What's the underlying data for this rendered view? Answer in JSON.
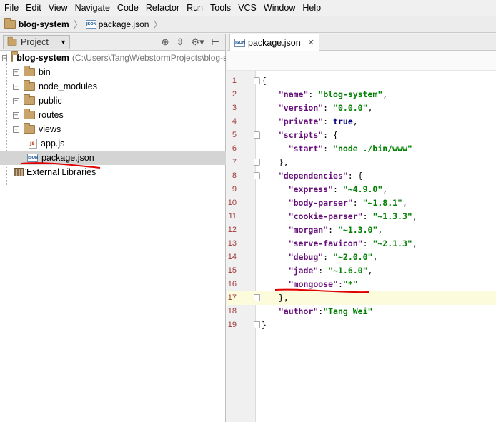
{
  "menu": [
    "File",
    "Edit",
    "View",
    "Navigate",
    "Code",
    "Refactor",
    "Run",
    "Tools",
    "VCS",
    "Window",
    "Help"
  ],
  "breadcrumb": {
    "project": "blog-system",
    "file": "package.json"
  },
  "project_panel": {
    "view_label": "Project",
    "root_name": "blog-system",
    "root_path": "(C:\\Users\\Tang\\WebstormProjects\\blog-system)",
    "items": [
      {
        "label": "bin",
        "kind": "folder"
      },
      {
        "label": "node_modules",
        "kind": "folder"
      },
      {
        "label": "public",
        "kind": "folder"
      },
      {
        "label": "routes",
        "kind": "folder"
      },
      {
        "label": "views",
        "kind": "folder"
      },
      {
        "label": "app.js",
        "kind": "js"
      },
      {
        "label": "package.json",
        "kind": "json",
        "selected": true
      }
    ],
    "external_libraries": "External Libraries"
  },
  "editor": {
    "tab_label": "package.json",
    "lines": [
      "{",
      "  \"name\": \"blog-system\",",
      "  \"version\": \"0.0.0\",",
      "  \"private\": true,",
      "  \"scripts\": {",
      "    \"start\": \"node ./bin/www\"",
      "  },",
      "  \"dependencies\": {",
      "    \"express\": \"~4.9.0\",",
      "    \"body-parser\": \"~1.8.1\",",
      "    \"cookie-parser\": \"~1.3.3\",",
      "    \"morgan\": \"~1.3.0\",",
      "    \"serve-favicon\": \"~2.1.3\",",
      "    \"debug\": \"~2.0.0\",",
      "    \"jade\": \"~1.6.0\",",
      "    \"mongoose\":\"*\"",
      "  },",
      "  \"author\":\"Tang Wei\"",
      "}"
    ],
    "current_line": 17
  },
  "colors": {
    "key": "#660e7a",
    "string": "#008000",
    "annotation_red": "#e00000",
    "current_line_bg": "#fcfcdc"
  }
}
